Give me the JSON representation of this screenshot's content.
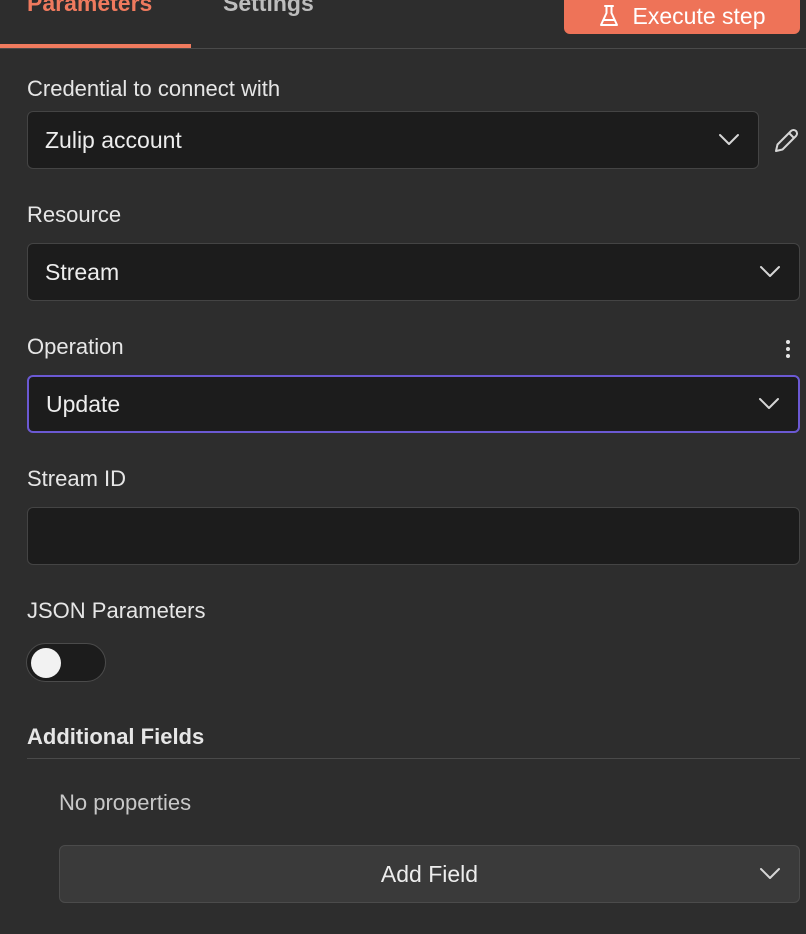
{
  "tabs": {
    "parameters": "Parameters",
    "settings": "Settings"
  },
  "execute_button": {
    "label": "Execute step",
    "icon": "flask-icon",
    "color": "#ee7358"
  },
  "accent_color": "#ef7a5e",
  "focus_color": "#6b59d3",
  "credential": {
    "label": "Credential to connect with",
    "value": "Zulip account"
  },
  "resource": {
    "label": "Resource",
    "value": "Stream"
  },
  "operation": {
    "label": "Operation",
    "value": "Update"
  },
  "stream_id": {
    "label": "Stream ID",
    "value": ""
  },
  "json_parameters": {
    "label": "JSON Parameters",
    "enabled": false
  },
  "additional_fields": {
    "title": "Additional Fields",
    "empty_text": "No properties",
    "add_button": "Add Field"
  }
}
